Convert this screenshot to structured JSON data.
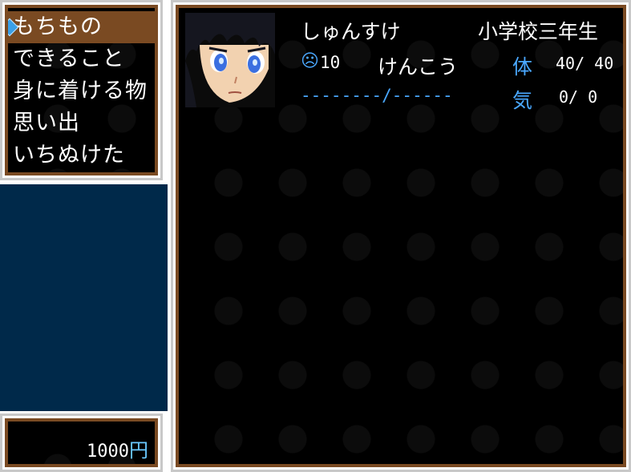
{
  "menu": {
    "items": [
      "もちもの",
      "できること",
      "身に着ける物",
      "思い出",
      "いちぬけた"
    ],
    "selected_index": 0
  },
  "money": {
    "amount": "1000",
    "unit": "円"
  },
  "character": {
    "name": "しゅんすけ",
    "grade": "小学校三年生",
    "mood_value": "10",
    "condition": "けんこう",
    "hp_label": "体",
    "hp_value": "40/ 40",
    "ki_label": "気",
    "ki_value": "0/  0",
    "equip_line": "--------/------"
  },
  "colors": {
    "frame_brown": "#7a4a22",
    "panel_blue": "#00294a",
    "accent_blue": "#4aa8ff"
  }
}
